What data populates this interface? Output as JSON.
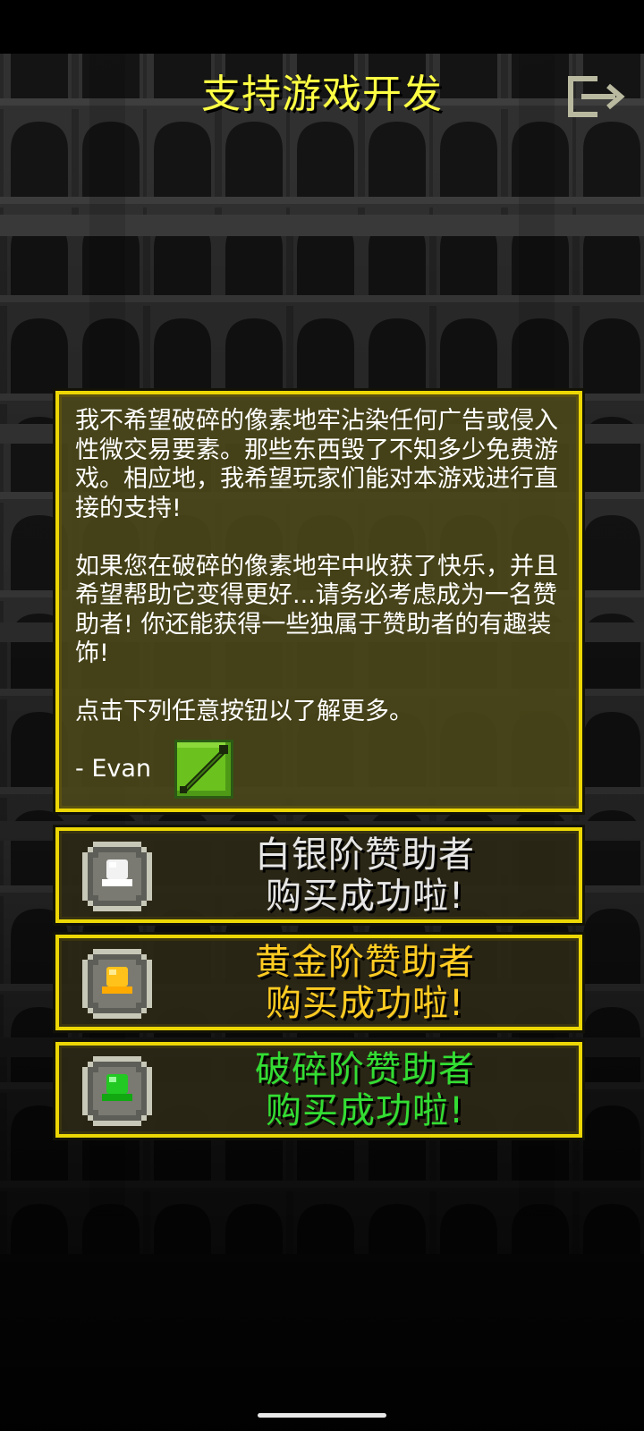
{
  "header": {
    "title": "支持游戏开发",
    "exit_icon": "exit-icon"
  },
  "message": {
    "paragraph_1": "我不希望破碎的像素地牢沾染任何广告或侵入性微交易要素。那些东西毁了不知多少免费游戏。相应地，我希望玩家们能对本游戏进行直接的支持!",
    "paragraph_2": "如果您在破碎的像素地牢中收获了快乐，并且希望帮助它变得更好...请务必考虑成为一名赞助者! 你还能获得一些独属于赞助者的有趣装饰!",
    "paragraph_3": "点击下列任意按钮以了解更多。",
    "signature": "- Evan",
    "signature_icon": "wand-icon"
  },
  "tiers": [
    {
      "line_1": "白银阶赞助者",
      "line_2": "购买成功啦!",
      "color": "#e6e6e6",
      "icon": "silver-supporter-icon",
      "gem_color": "#f2f2f2"
    },
    {
      "line_1": "黄金阶赞助者",
      "line_2": "购买成功啦!",
      "color": "#ffcc22",
      "icon": "gold-supporter-icon",
      "gem_color": "#ffc21a"
    },
    {
      "line_1": "破碎阶赞助者",
      "line_2": "购买成功啦!",
      "color": "#33dd33",
      "icon": "shattered-supporter-icon",
      "gem_color": "#22c922"
    }
  ],
  "colors": {
    "title": "#ffff44",
    "panel_border": "#ecd705",
    "panel_fill": "#4a4618"
  }
}
